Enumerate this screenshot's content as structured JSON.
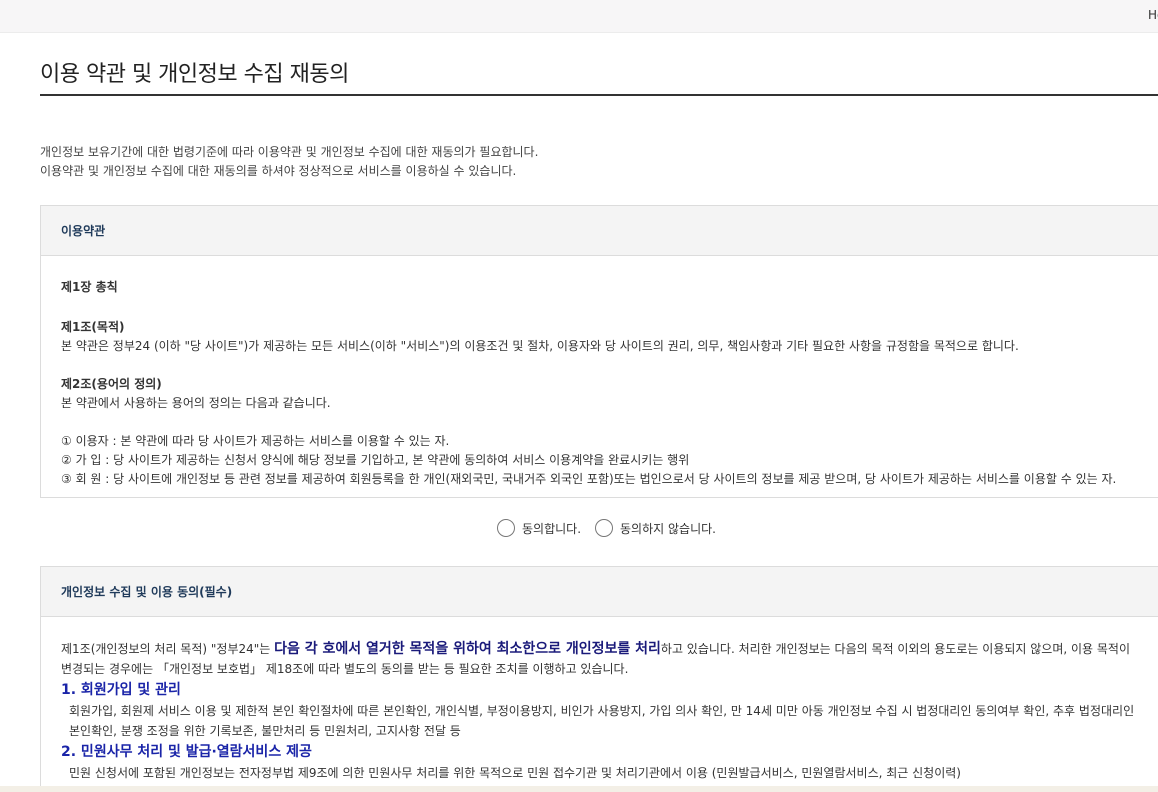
{
  "topbar": {
    "cut_text": "Ho"
  },
  "page": {
    "title": "이용 약관 및 개인정보 수집 재동의"
  },
  "intro": [
    "개인정보 보유기간에 대한 법령기준에 따라 이용약관 및 개인정보 수집에 대한 재동의가 필요합니다.",
    "이용약관 및 개인정보 수집에 대한 재동의를 하셔야 정상적으로 서비스를 이용하실 수 있습니다."
  ],
  "terms": {
    "header": "이용약관",
    "chapter": "제1장 총칙",
    "art1_title": "제1조(목적)",
    "art1_body": "본 약관은 정부24 (이하 \"당 사이트\")가 제공하는 모든 서비스(이하 \"서비스\")의 이용조건 및 절차, 이용자와 당 사이트의 권리, 의무, 책임사항과 기타 필요한 사항을 규정함을 목적으로 합니다.",
    "art2_title": "제2조(용어의 정의)",
    "art2_body": "본 약관에서 사용하는 용어의 정의는 다음과 같습니다.",
    "def1": "① 이용자 : 본 약관에 따라 당 사이트가 제공하는 서비스를 이용할 수 있는 자.",
    "def2": "② 가 입 : 당 사이트가 제공하는 신청서 양식에 해당 정보를 기입하고, 본 약관에 동의하여 서비스 이용계약을 완료시키는 행위",
    "def3": "③ 회 원 : 당 사이트에 개인정보 등 관련 정보를 제공하여 회원등록을 한 개인(재외국민, 국내거주 외국인 포함)또는 법인으로서 당 사이트의 정보를 제공 받으며, 당 사이트가 제공하는 서비스를 이용할 수 있는 자."
  },
  "consent": {
    "agree": "동의합니다.",
    "disagree": "동의하지 않습니다."
  },
  "privacy": {
    "header": "개인정보 수집 및 이용 동의(필수)",
    "lead_a": "제1조(개인정보의 처리 목적) \"정부24\"는 ",
    "lead_em": "다음 각 호에서 열거한 목적을 위하여 최소한으로 개인정보를 처리",
    "lead_b": "하고 있습니다. 처리한 개인정보는 다음의 목적 이외의 용도로는 이용되지 않으며, 이용 목적이 변경되는 경우에는 「개인정보 보호법」 제18조에 따라 별도의 동의를 받는 등 필요한 조치를 이행하고 있습니다.",
    "sec1_title": "1. 회원가입 및 관리",
    "sec1_body": "회원가입, 회원제 서비스 이용 및 제한적 본인 확인절차에 따른 본인확인, 개인식별, 부정이용방지, 비인가 사용방지, 가입 의사 확인, 만 14세 미만 아동 개인정보 수집 시 법정대리인 동의여부 확인, 추후 법정대리인 본인확인, 분쟁 조정을 위한 기록보존, 불만처리 등 민원처리, 고지사항 전달 등",
    "sec2_title": "2. 민원사무 처리 및 발급·열람서비스 제공",
    "sec2_body": "민원 신청서에 포함된 개인정보는 전자정부법 제9조에 의한 민원사무 처리를 위한 목적으로 민원 접수기관 및 처리기관에서 이용 (민원발급서비스, 민원열람서비스, 최근 신청이력)"
  }
}
